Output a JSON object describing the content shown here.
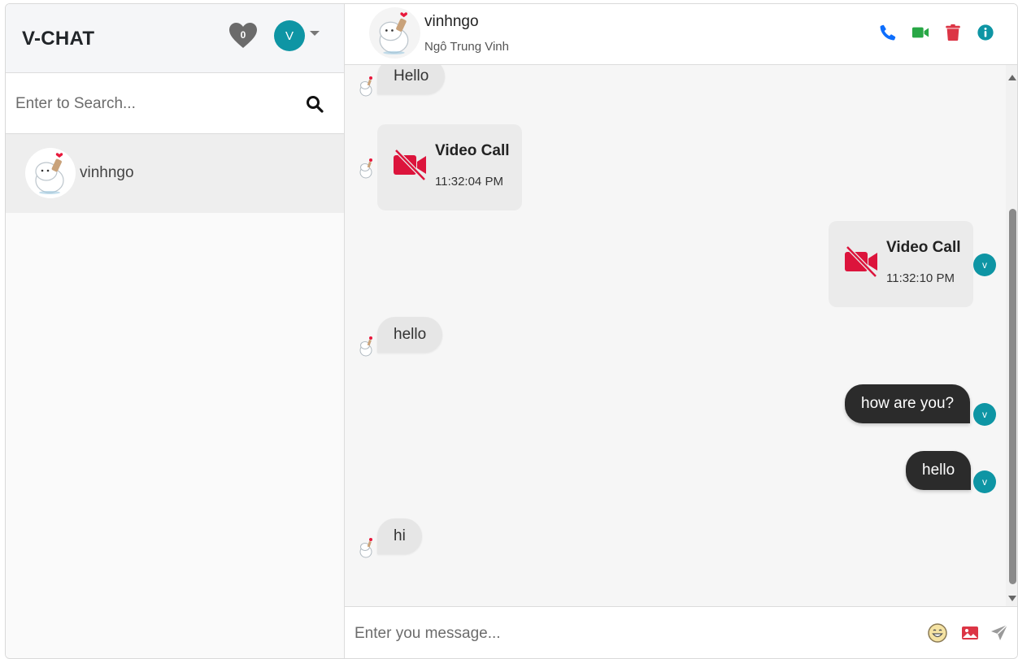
{
  "app": {
    "brand": "V-CHAT"
  },
  "header": {
    "favorites_count": "0",
    "user_initial": "V"
  },
  "search": {
    "placeholder": "Enter to Search..."
  },
  "contacts": [
    {
      "name": "vinhngo"
    }
  ],
  "chat": {
    "username": "vinhngo",
    "full_name": "Ngô Trung Vinh",
    "actions": [
      "phone-icon",
      "video-icon",
      "trash-icon",
      "info-icon"
    ]
  },
  "messages": [
    {
      "direction": "in",
      "type": "text",
      "text": "Hello"
    },
    {
      "direction": "in",
      "type": "call",
      "title": "Video Call",
      "time": "11:32:04 PM"
    },
    {
      "direction": "out",
      "type": "call",
      "title": "Video Call",
      "time": "11:32:10 PM",
      "avatar": "v"
    },
    {
      "direction": "in",
      "type": "text",
      "text": "hello"
    },
    {
      "direction": "out",
      "type": "text",
      "text": "how are you?",
      "avatar": "v"
    },
    {
      "direction": "out",
      "type": "text",
      "text": "hello",
      "avatar": "v"
    },
    {
      "direction": "in",
      "type": "text",
      "text": "hi"
    }
  ],
  "composer": {
    "placeholder": "Enter you message..."
  },
  "colors": {
    "accent_teal": "#0e95a4",
    "phone_blue": "#0d6efd",
    "video_green": "#28a745",
    "delete_red": "#dc3545",
    "missed_call_red": "#dc143c",
    "outgoing_bubble": "#2b2b2b"
  }
}
